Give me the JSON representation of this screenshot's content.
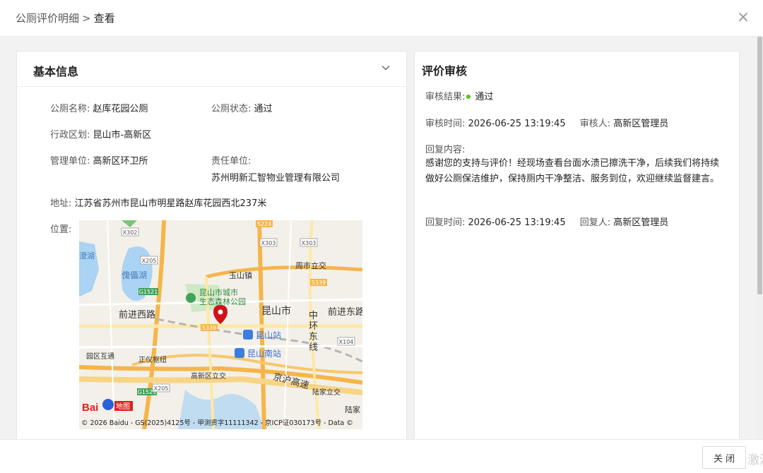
{
  "header": {
    "breadcrumb_parent": "公厕评价明细",
    "breadcrumb_sep": ">",
    "breadcrumb_current": "查看",
    "close_icon": "×"
  },
  "basic_info": {
    "title": "基本信息",
    "toilet_name_label": "公厕名称:",
    "toilet_name": "赵库花园公厕",
    "toilet_status_label": "公厕状态:",
    "toilet_status": "通过",
    "district_label": "行政区划:",
    "district": "昆山市-高新区",
    "mgmt_unit_label": "管理单位:",
    "mgmt_unit": "高新区环卫所",
    "resp_unit_label": "责任单位:",
    "resp_unit": "苏州明新汇智物业管理有限公司",
    "address_label": "地址:",
    "address": "江苏省苏州市昆山市明星路赵库花园西北237米",
    "location_label": "位置:"
  },
  "map": {
    "labels": {
      "lake1": "澄湖",
      "lake2": "傀儡湖",
      "town": "玉山镇",
      "interchange1": "周市立交",
      "park": "昆山市城市",
      "park2": "生态森林公园",
      "city": "昆山市",
      "road_w": "前进西路",
      "road_e": "前进东路",
      "ring": "中",
      "ring2": "环",
      "ring3": "东",
      "ring4": "线",
      "station1": "昆山站",
      "station2": "昆山南站",
      "yuqu": "园区互通",
      "zhengyi": "正仪枢纽",
      "gxq": "高新区立交",
      "highway": "京沪高速",
      "lujia_ic": "陆家立交",
      "lujia": "陆家",
      "x302": "X302",
      "x205a": "X205",
      "x205b": "X205",
      "s224": "S224",
      "x303a": "X303",
      "x303b": "X303",
      "s339a": "S339",
      "s339b": "S339",
      "g1521a": "G1521",
      "g1521b": "G1521",
      "x104": "X104",
      "brand": "Bai",
      "brand2": "地图",
      "copyright": "© 2026 Baidu - GS(2025)4125号 - 甲测资字11111342 - 京ICP证030173号 - Data ©"
    }
  },
  "review": {
    "title": "评价审核",
    "result_label": "审核结果:",
    "result_value": "通过",
    "status_color": "#52c41a",
    "review_time_label": "审核时间:",
    "review_time": "2026-06-25 13:19:45",
    "reviewer_label": "审核人:",
    "reviewer": "高新区管理员",
    "reply_content_label": "回复内容:",
    "reply_content": "感谢您的支持与评价！经现场查看台面水渍已擦洗干净，后续我们将持续做好公厕保洁维护，保持厕内干净整洁、服务到位，欢迎继续监督建言。",
    "reply_time_label": "回复时间:",
    "reply_time": "2026-06-25 13:19:45",
    "replier_label": "回复人:",
    "replier": "高新区管理员"
  },
  "footer": {
    "close_label": "关 闭",
    "watermark": "激活"
  }
}
